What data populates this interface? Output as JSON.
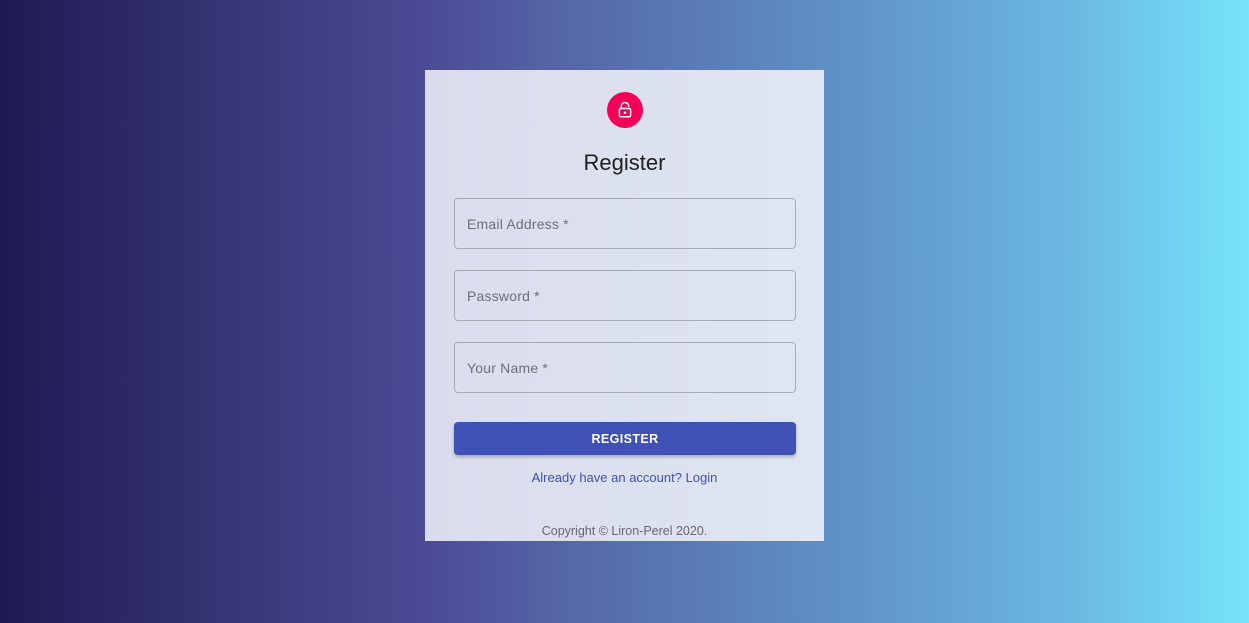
{
  "form": {
    "title": "Register",
    "icon": "lock-icon",
    "accent_color": "#f50057",
    "button_color": "#3f51b5",
    "fields": {
      "email_placeholder": "Email Address *",
      "password_placeholder": "Password *",
      "name_placeholder": "Your Name *"
    },
    "submit_label": "REGISTER",
    "login_link": "Already have an account? Login"
  },
  "footer": {
    "copyright": "Copyright © Liron-Perel 2020."
  }
}
